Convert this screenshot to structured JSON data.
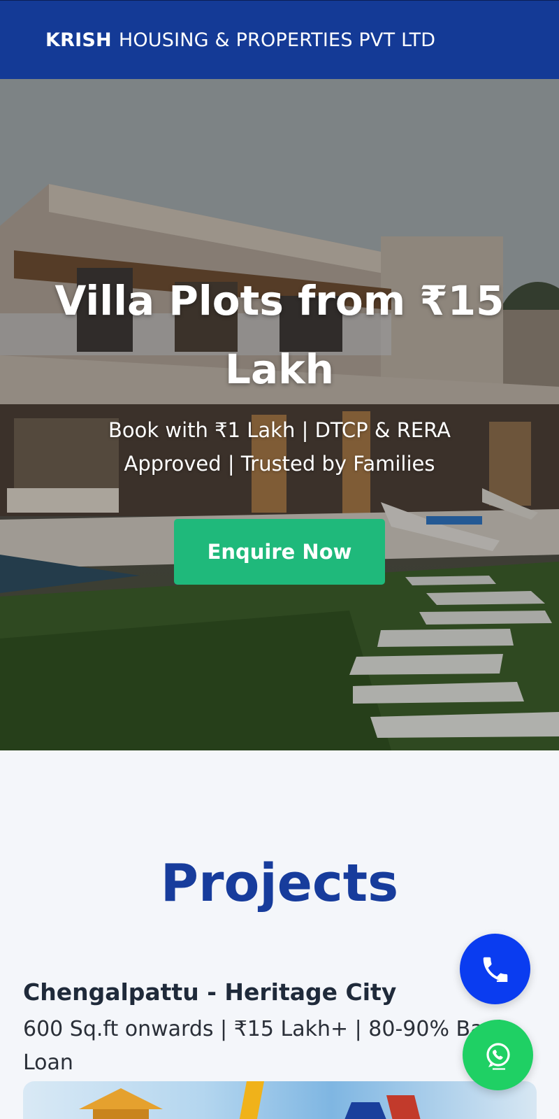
{
  "header": {
    "brand_strong": "KRISH",
    "brand_rest": "HOUSING & PROPERTIES PVT LTD"
  },
  "hero": {
    "title": "Villa Plots from ₹15 Lakh",
    "subtitle": "Book with ₹1 Lakh | DTCP & RERA Approved | Trusted by Families",
    "cta_label": "Enquire Now"
  },
  "projects": {
    "heading": "Projects",
    "items": [
      {
        "name": "Chengalpattu - Heritage City",
        "description": "600 Sq.ft onwards | ₹15 Lakh+ | 80-90% Bank Loan"
      }
    ]
  },
  "floating": {
    "call_icon": "phone-icon",
    "whatsapp_icon": "whatsapp-icon"
  },
  "colors": {
    "header_bg": "#143a96",
    "cta_bg": "#1fb97b",
    "heading": "#173c9c",
    "call_fab": "#0a3cf0",
    "whatsapp_fab": "#1fd064"
  }
}
